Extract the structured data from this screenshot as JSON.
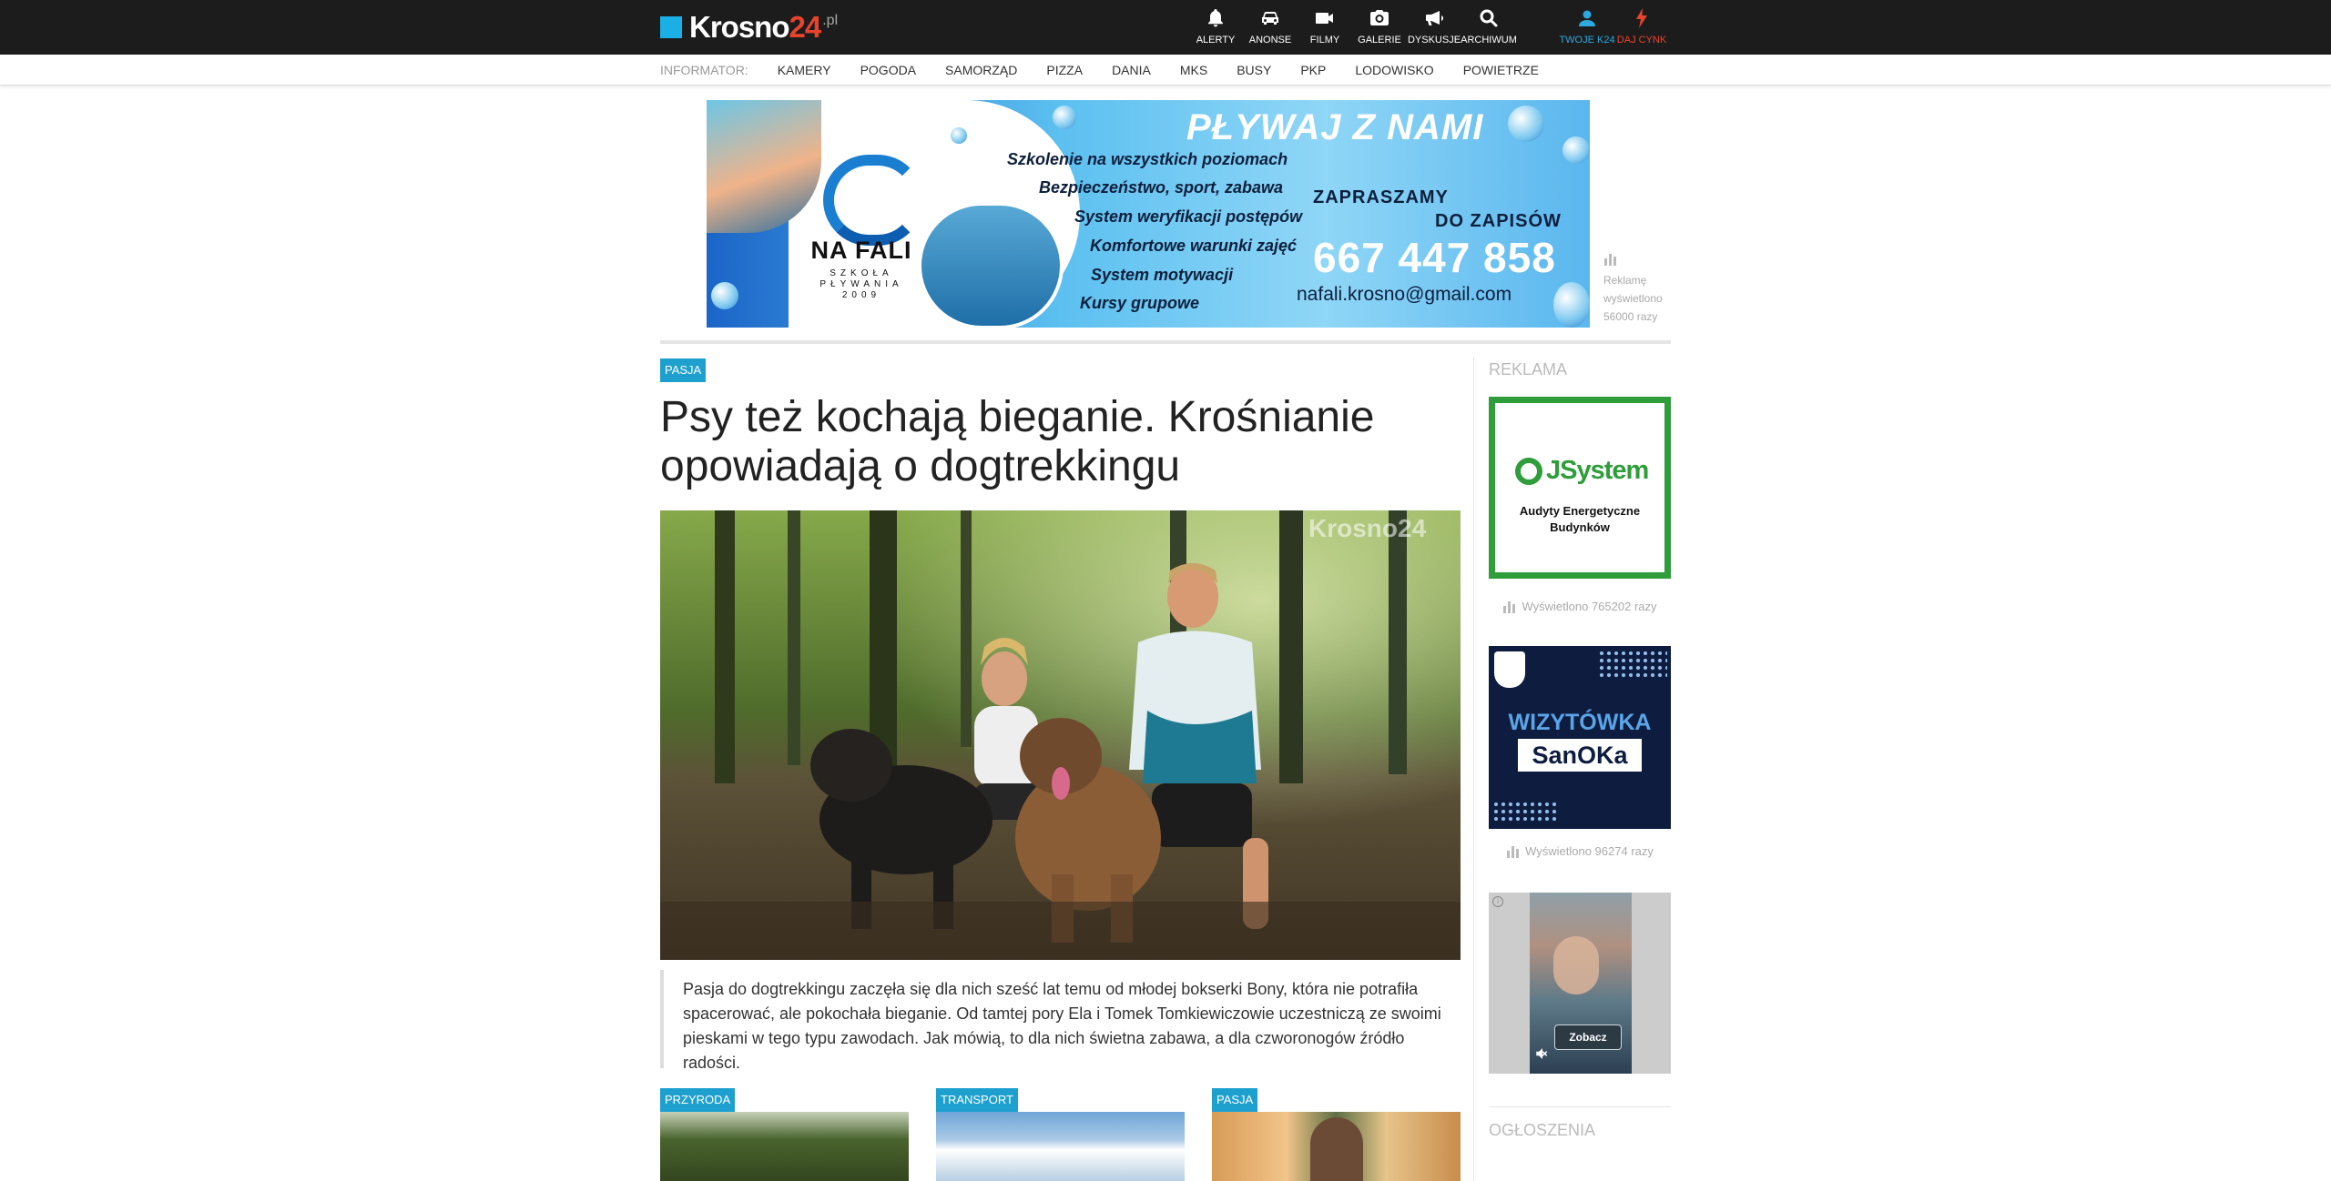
{
  "site": {
    "logo_text": "Krosno",
    "logo_number": "24",
    "logo_suffix": ".pl"
  },
  "top_nav": [
    {
      "label": "ALERTY",
      "icon": "bell-icon"
    },
    {
      "label": "ANONSE",
      "icon": "car-icon"
    },
    {
      "label": "FILMY",
      "icon": "video-camera-icon"
    },
    {
      "label": "GALERIE",
      "icon": "photo-camera-icon"
    },
    {
      "label": "DYSKUSJE",
      "icon": "megaphone-icon"
    },
    {
      "label": "ARCHIWUM",
      "icon": "search-icon"
    }
  ],
  "top_nav_right": [
    {
      "label": "TWOJE K24",
      "icon": "user-icon",
      "color": "#2ea8e0"
    },
    {
      "label": "DAJ CYNK",
      "icon": "lightning-icon",
      "color": "#e8442c"
    }
  ],
  "informator": {
    "label": "INFORMATOR:",
    "links": [
      "KAMERY",
      "POGODA",
      "SAMORZĄD",
      "PIZZA",
      "DANIA",
      "MKS",
      "BUSY",
      "PKP",
      "LODOWISKO",
      "POWIETRZE"
    ]
  },
  "banner": {
    "title": "PŁYWAJ Z NAMI",
    "brand_name": "NA FALI",
    "brand_sub": "SZKOŁA PŁYWANIA 2009",
    "lines": [
      "Szkolenie na wszystkich poziomach",
      "Bezpieczeństwo, sport, zabawa",
      "System weryfikacji postępów",
      "Komfortowe warunki zajęć",
      "System motywacji",
      "Kursy grupowe"
    ],
    "cta_line1": "ZAPRASZAMY",
    "cta_line2": "DO ZAPISÓW",
    "phone": "667 447 858",
    "email": "nafali.krosno@gmail.com",
    "stats_line1": "Reklamę",
    "stats_line2": "wyświetlono",
    "stats_line3": "56000 razy"
  },
  "article": {
    "category": "PASJA",
    "title": "Psy też kochają bieganie. Krośnianie opowiadają o dogtrekkingu",
    "photo_watermark": "Krosno24",
    "lead": "Pasja do dogtrekkingu zaczęła się dla nich sześć lat temu od młodej bokserki Bony, która nie potrafiła spacerować, ale pokochała bieganie. Od tamtej pory Ela i Tomek Tomkiewiczowie uczestniczą ze swoimi pieskami w tego typu zawodach. Jak mówią, to dla nich świetna zabawa, a dla czworonogów źródło radości."
  },
  "related": [
    {
      "category": "PRZYRODA"
    },
    {
      "category": "TRANSPORT"
    },
    {
      "category": "PASJA"
    }
  ],
  "sidebar": {
    "ads_heading": "REKLAMA",
    "ad1": {
      "brand": "JSystem",
      "tagline": "Audyty Energetyczne Budynków",
      "stats": "Wyświetlono 765202 razy",
      "accent": "#2e9d3a"
    },
    "ad2": {
      "line1": "WIZYTÓWKA",
      "line2": "SanOKa",
      "stats": "Wyświetlono 96274 razy"
    },
    "ad3": {
      "button": "Zobacz"
    },
    "classifieds_heading": "OGŁOSZENIA"
  }
}
